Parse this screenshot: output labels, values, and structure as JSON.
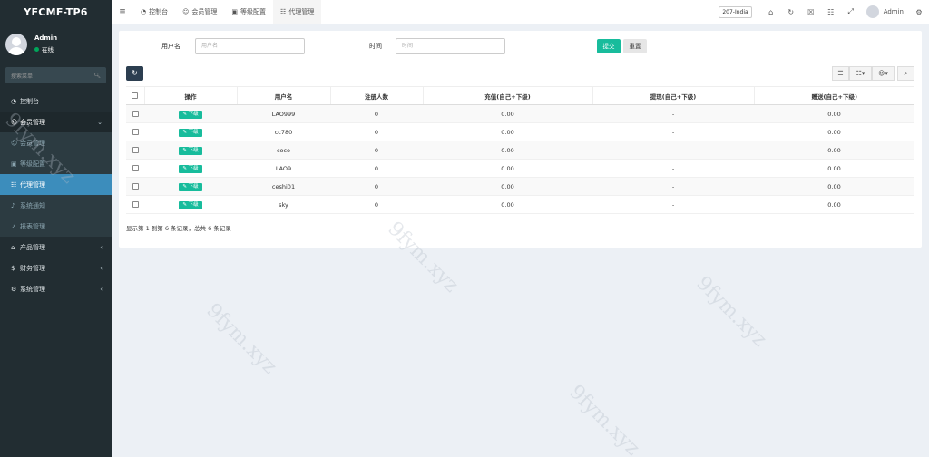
{
  "brand": "YFCMF-TP6",
  "user": {
    "name": "Admin",
    "status": "在线"
  },
  "sidebar": {
    "search_placeholder": "搜索菜单",
    "items": [
      {
        "label": "控制台",
        "icon": "dashboard-icon"
      },
      {
        "label": "会员管理",
        "icon": "user-icon",
        "open": true
      },
      {
        "label": "会员管理",
        "icon": "user-icon",
        "sub": true
      },
      {
        "label": "等级配置",
        "icon": "level-icon",
        "sub": true
      },
      {
        "label": "代理管理",
        "icon": "sitemap-icon",
        "active": true
      },
      {
        "label": "系统通知",
        "icon": "bell-icon",
        "sub": true
      },
      {
        "label": "报表管理",
        "icon": "chart-icon",
        "sub": true
      },
      {
        "label": "产品管理",
        "icon": "home-icon"
      },
      {
        "label": "财务管理",
        "icon": "money-icon"
      },
      {
        "label": "系统管理",
        "icon": "cogs-icon"
      }
    ]
  },
  "topbar": {
    "tabs": [
      {
        "label": "控制台",
        "icon": "dashboard-icon"
      },
      {
        "label": "会员管理",
        "icon": "user-icon"
      },
      {
        "label": "等级配置",
        "icon": "level-icon"
      },
      {
        "label": "代理管理",
        "icon": "sitemap-icon",
        "active": true
      }
    ],
    "region": "207-India",
    "user": "Admin"
  },
  "filter": {
    "username_label": "用户名",
    "username_placeholder": "用户名",
    "time_label": "时间",
    "time_placeholder": "时间",
    "submit": "提交",
    "reset": "重置"
  },
  "table": {
    "headers": [
      "操作",
      "用户名",
      "注册人数",
      "充值(自己+下级)",
      "提现(自己+下级)",
      "赠送(自己+下级)"
    ],
    "action_label": "下级",
    "rows": [
      {
        "username": "LAO999",
        "reg": "0",
        "recharge": "0.00",
        "withdraw": "-",
        "gift": "0.00"
      },
      {
        "username": "cc780",
        "reg": "0",
        "recharge": "0.00",
        "withdraw": "-",
        "gift": "0.00"
      },
      {
        "username": "coco",
        "reg": "0",
        "recharge": "0.00",
        "withdraw": "-",
        "gift": "0.00"
      },
      {
        "username": "LAO9",
        "reg": "0",
        "recharge": "0.00",
        "withdraw": "-",
        "gift": "0.00"
      },
      {
        "username": "ceshi01",
        "reg": "0",
        "recharge": "0.00",
        "withdraw": "-",
        "gift": "0.00"
      },
      {
        "username": "sky",
        "reg": "0",
        "recharge": "0.00",
        "withdraw": "-",
        "gift": "0.00"
      }
    ],
    "pager": "显示第 1 到第 6 条记录，总共 6 条记录"
  },
  "watermark": "9fym.xyz"
}
